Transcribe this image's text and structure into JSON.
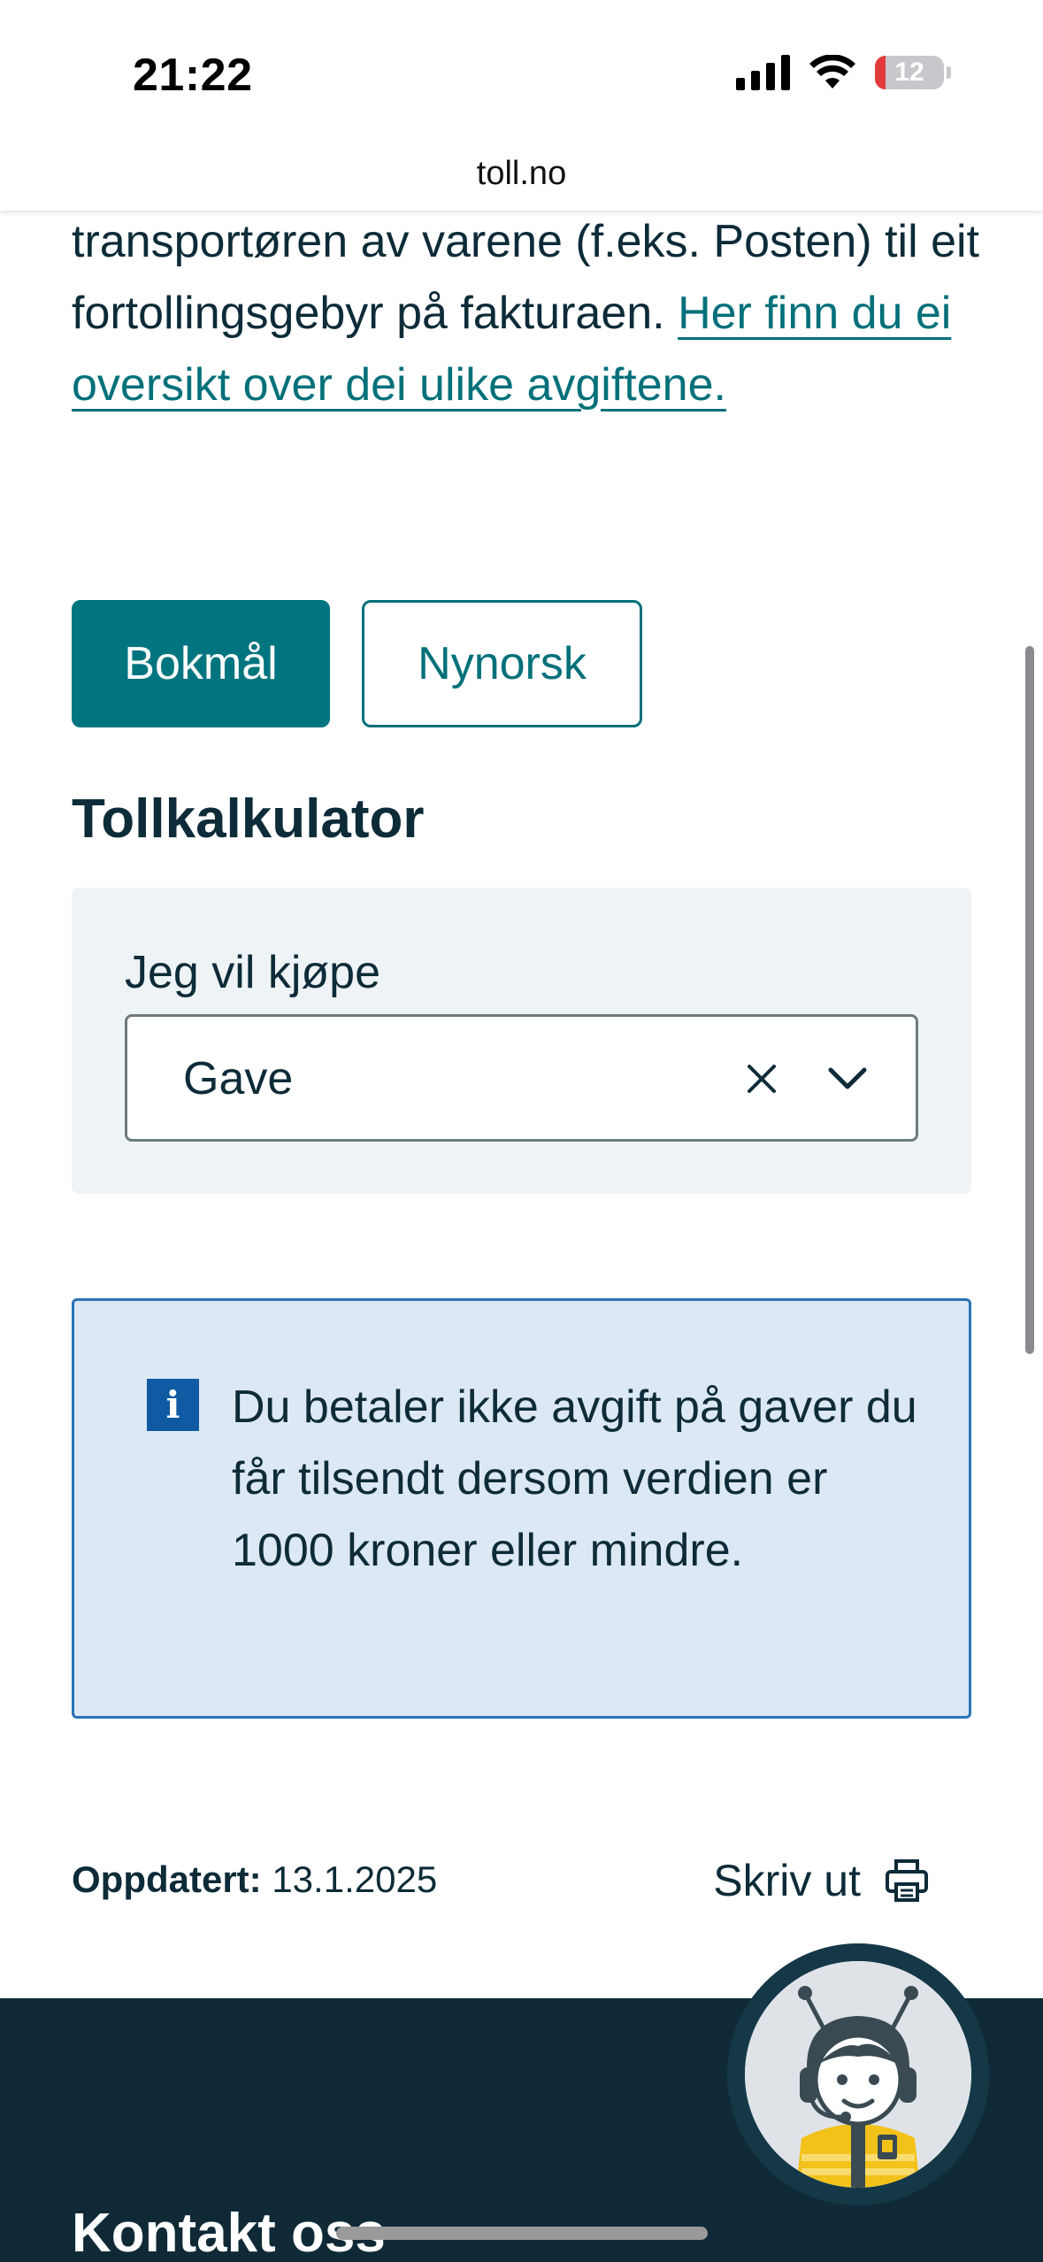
{
  "status_bar": {
    "time": "21:22",
    "battery_level": "12",
    "icons": [
      "cellular-signal-icon",
      "wifi-icon",
      "battery-icon"
    ]
  },
  "browser": {
    "url": "toll.no"
  },
  "intro": {
    "text": "transportøren av varene (f.eks. Posten) til eit fortollingsgebyr på fakturaen. ",
    "link_text": "Her finn du ei oversikt over dei ulike avgiftene."
  },
  "language_buttons": {
    "bokmal": "Bokmål",
    "nynorsk": "Nynorsk",
    "selected": "Bokmål"
  },
  "calculator": {
    "title": "Tollkalkulator",
    "field_label": "Jeg vil kjøpe",
    "selected_value": "Gave"
  },
  "info": {
    "icon": "info-icon",
    "text": "Du betaler ikke avgift på gaver du får tilsendt dersom verdien er 1000 kroner eller mindre."
  },
  "meta": {
    "updated_label": "Oppdatert:",
    "updated_date": "13.1.2025",
    "print_label": "Skriv ut"
  },
  "footer": {
    "contact_title": "Kontakt oss"
  },
  "colors": {
    "teal": "#00757f",
    "dark": "#0d2b38",
    "info_bg": "#dce8f4",
    "info_border": "#2b73b6",
    "footer_bg": "#0f2a36"
  }
}
